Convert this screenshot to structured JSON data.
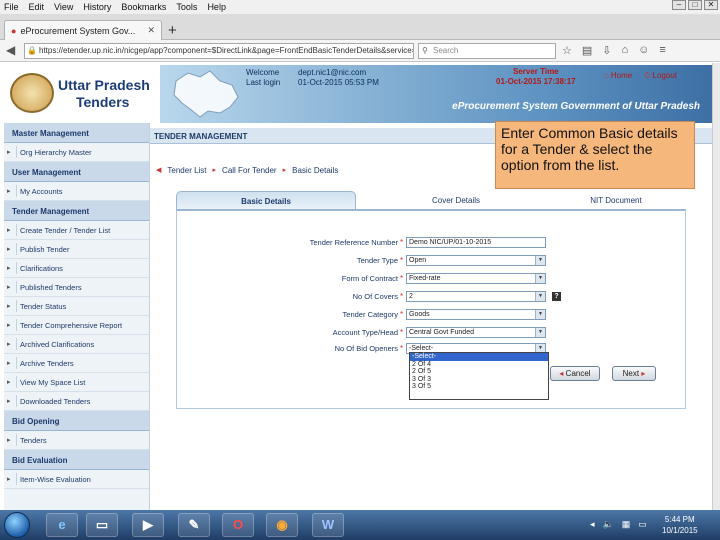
{
  "browser": {
    "menu": [
      "File",
      "Edit",
      "View",
      "History",
      "Bookmarks",
      "Tools",
      "Help"
    ],
    "tab_title": "eProcurement System Gov...",
    "url": "https://etender.up.nic.in/nicgep/app?component=$DirectLink&page=FrontEndBasicTenderDetails&service=dire",
    "search_placeholder": "Search",
    "window_buttons": [
      "–",
      "□",
      "✕"
    ]
  },
  "header": {
    "site_name_line1": "Uttar Pradesh",
    "site_name_line2": "Tenders",
    "welcome_label": "Welcome",
    "welcome_value": "dept.nic1@nic.com",
    "last_login_label": "Last login",
    "last_login_value": "01-Oct-2015 05:53 PM",
    "server_time_label": "Server Time",
    "server_time_value": "01-Oct-2015 17:38:17",
    "home_link": "Home",
    "logout_link": "Logout",
    "portal_title": "eProcurement System Government of Uttar Pradesh"
  },
  "sidebar": {
    "sections": [
      {
        "title": "Master Management",
        "items": [
          "Org Hierarchy Master"
        ]
      },
      {
        "title": "User Management",
        "items": [
          "My Accounts"
        ]
      },
      {
        "title": "Tender Management",
        "items": [
          "Create Tender / Tender List",
          "Publish Tender",
          "Clarifications",
          "Published Tenders",
          "Tender Status",
          "Tender Comprehensive Report",
          "Archived Clarifications",
          "Archive Tenders",
          "View My Space List",
          "Downloaded Tenders"
        ]
      },
      {
        "title": "Bid Opening",
        "items": [
          "Tenders"
        ]
      },
      {
        "title": "Bid Evaluation",
        "items": [
          "Item-Wise Evaluation"
        ]
      }
    ]
  },
  "main": {
    "title": "TENDER MANAGEMENT",
    "breadcrumb": [
      "Tender List",
      "Call For Tender",
      "Basic Details"
    ],
    "tabs": [
      "Basic Details",
      "Cover Details",
      "NIT Document"
    ],
    "tooltip": "Enter Common Basic details for a Tender & select the option from the list.",
    "fields": [
      {
        "label": "Tender Reference Number",
        "value": "Demo NIC/UP/01-10-2015",
        "type": "text"
      },
      {
        "label": "Tender Type",
        "value": "Open",
        "type": "select"
      },
      {
        "label": "Form of Contract",
        "value": "Fixed-rate",
        "type": "select"
      },
      {
        "label": "No Of Covers",
        "value": "2",
        "type": "select"
      },
      {
        "label": "Tender Category",
        "value": "Goods",
        "type": "select"
      },
      {
        "label": "Account Type/Head",
        "value": "Central Govt Funded",
        "type": "select"
      },
      {
        "label": "No Of Bid Openers",
        "value": "-Select-",
        "type": "select"
      }
    ],
    "bid_openers_options": [
      "-Select-",
      "2 Of 4",
      "2 Of 5",
      "3 Of 3",
      "3 Of 5"
    ],
    "help_glyph": "?",
    "cancel_label": "Cancel",
    "next_label": "Next"
  },
  "taskbar": {
    "time": "5:44 PM",
    "date": "10/1/2015"
  }
}
